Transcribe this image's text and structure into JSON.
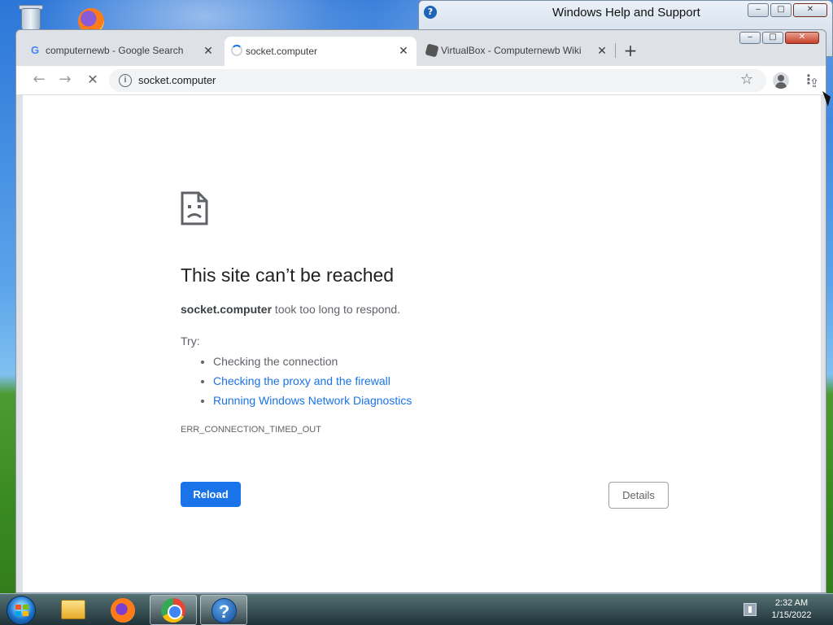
{
  "help_window": {
    "title": "Windows Help and Support",
    "minimize_label": "‒",
    "maximize_label": "□",
    "close_label": "✕"
  },
  "chrome": {
    "frame": {
      "minimize_label": "‒",
      "maximize_label": "□",
      "close_label": "✕"
    },
    "tabs": [
      {
        "label": "computernewb - Google Search",
        "favicon": "google-g-icon",
        "close": "✕"
      },
      {
        "label": "socket.computer",
        "favicon": "loading-spinner-icon",
        "close": "✕"
      },
      {
        "label": "VirtualBox - Computernewb Wiki",
        "favicon": "virtualbox-icon",
        "close": "✕"
      }
    ],
    "new_tab_label": "+",
    "toolbar": {
      "back": "←",
      "forward": "→",
      "stop": "✕",
      "info_icon": "i",
      "url": "socket.computer",
      "share": "⇪",
      "star": "☆",
      "menu": "⋮"
    }
  },
  "error_page": {
    "headline": "This site can’t be reached",
    "host": "socket.computer",
    "detail_rest": " took too long to respond.",
    "try_label": "Try:",
    "suggestions": [
      {
        "label": "Checking the connection",
        "is_link": false
      },
      {
        "label": "Checking the proxy and the firewall",
        "is_link": true
      },
      {
        "label": "Running Windows Network Diagnostics",
        "is_link": true
      }
    ],
    "error_code": "ERR_CONNECTION_TIMED_OUT",
    "reload_label": "Reload",
    "details_label": "Details"
  },
  "taskbar": {
    "help_glyph": "?",
    "clock_time": "2:32 AM",
    "clock_date": "1/15/2022"
  },
  "colors": {
    "accent": "#1a73e8",
    "text_primary": "#202124",
    "text_secondary": "#5f6368"
  }
}
